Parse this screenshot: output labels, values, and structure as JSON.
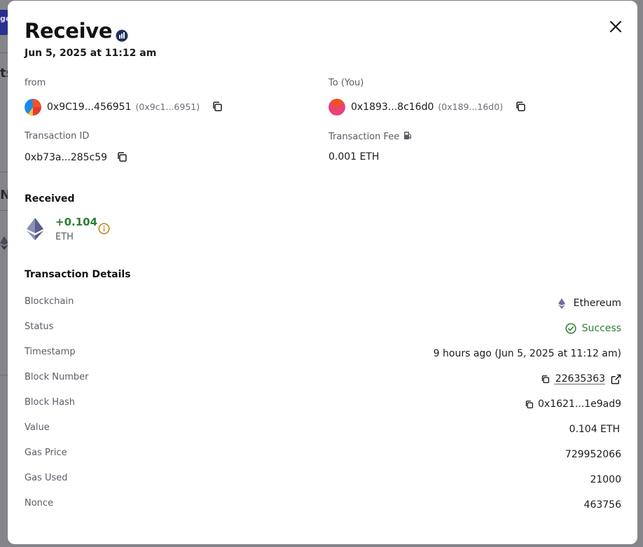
{
  "modal": {
    "title": "Receive",
    "date": "Jun 5, 2025 at 11:12 am"
  },
  "from": {
    "label": "from",
    "address": "0x9C19...456951",
    "short": "(0x9c1...6951)"
  },
  "to": {
    "label": "To (You)",
    "address": "0x1893...8c16d0",
    "short": "(0x189...16d0)"
  },
  "transaction_id": {
    "label": "Transaction ID",
    "value": "0xb73a...285c59"
  },
  "transaction_fee": {
    "label": "Transaction Fee",
    "value": "0.001 ETH"
  },
  "received": {
    "title": "Received",
    "amount": "+0.104",
    "asset": "ETH"
  },
  "details": {
    "title": "Transaction Details",
    "rows": [
      {
        "label": "Blockchain",
        "value": "Ethereum"
      },
      {
        "label": "Status",
        "value": "Success"
      },
      {
        "label": "Timestamp",
        "value": "9 hours ago (Jun 5, 2025 at 11:12 am)"
      },
      {
        "label": "Block Number",
        "value": "22635363"
      },
      {
        "label": "Block Hash",
        "value": "0x1621...1e9ad9"
      },
      {
        "label": "Value",
        "value": "0.104 ETH"
      },
      {
        "label": "Gas Price",
        "value": "729952066"
      },
      {
        "label": "Gas Used",
        "value": "21000"
      },
      {
        "label": "Nonce",
        "value": "463756"
      }
    ]
  },
  "background": {
    "fragments": [
      "ge",
      "ts",
      "N"
    ]
  },
  "colors": {
    "success": "#2e7d32",
    "info": "#b8860b",
    "overlay": "#86868a",
    "accent": "#2b2f8f"
  },
  "icons": {
    "close": "close-icon",
    "copy": "copy-icon",
    "info": "info-icon",
    "external": "external-link-icon",
    "gas": "gas-pump-icon",
    "success": "check-circle-icon",
    "eth": "ethereum-icon"
  }
}
